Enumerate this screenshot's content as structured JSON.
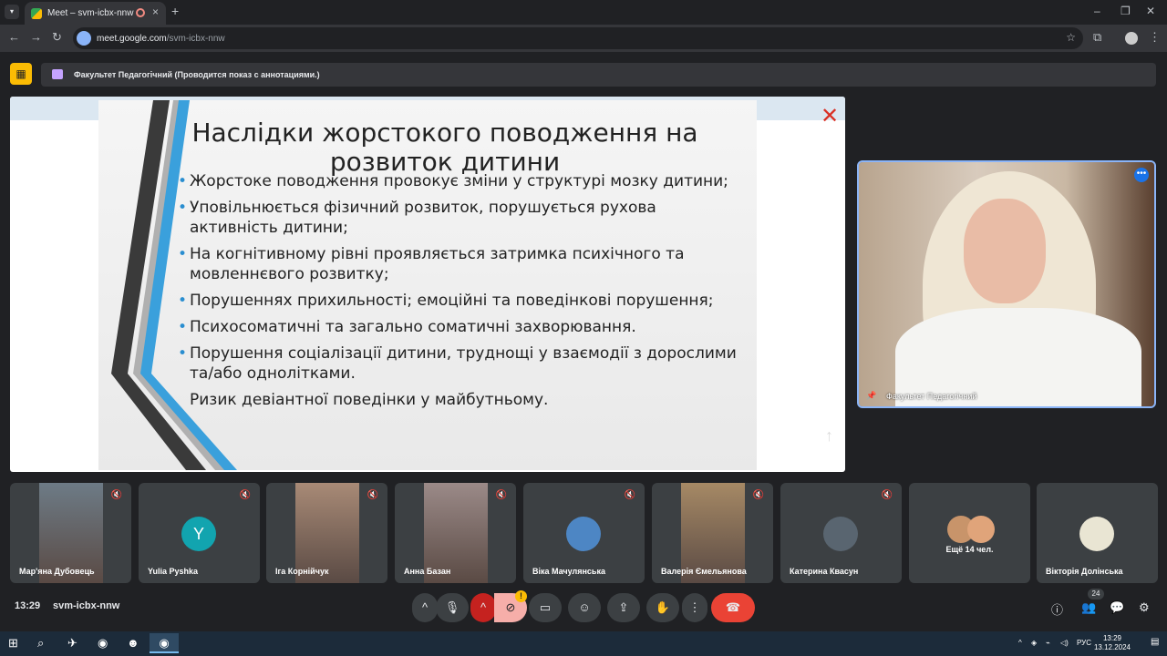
{
  "browser": {
    "tab_title": "Meet – svm-icbx-nnw",
    "new_tab": "+",
    "url_host": "meet.google.com",
    "url_path": "/svm-icbx-nnw"
  },
  "banner": {
    "text": "Факультет Педагогічний (Проводится показ с аннотациями.)"
  },
  "slide": {
    "title": "Наслідки жорстокого поводження на розвиток дитини",
    "bullets": [
      "Жорстоке поводження провокує зміни у структурі мозку дитини;",
      "Уповільнюється фізичний розвиток, порушується рухова активність дитини;",
      "На когнітивному рівні проявляється затримка психічного та мовленнєвого розвитку;",
      "Порушеннях прихильності; емоційні та поведінкові порушення;",
      "Психосоматичні та загально соматичні захворювання.",
      "Порушення соціалізації дитини, труднощі у взаємодії з дорослими та/або однолітками.",
      "Ризик девіантної поведінки у майбутньому."
    ]
  },
  "speaker": {
    "name": "Факультет Педагогічний"
  },
  "participants": [
    {
      "name": "Мар'яна Дубовець",
      "avatar": "",
      "color": "#6d7b86"
    },
    {
      "name": "Yulia Pyshka",
      "avatar": "Y",
      "color": "#12a4af"
    },
    {
      "name": "Іга Корнійчук",
      "avatar": "",
      "color": "#a88a76"
    },
    {
      "name": "Анна Базан",
      "avatar": "",
      "color": "#9b8a88"
    },
    {
      "name": "Віка Мачулянська",
      "avatar": "",
      "color": "#4d86c4"
    },
    {
      "name": "Валерія Ємельянова",
      "avatar": "",
      "color": "#a68965"
    },
    {
      "name": "Катерина Квасун",
      "avatar": "",
      "color": "#596570"
    },
    {
      "name": "Ещё 14 чел.",
      "avatar": "",
      "color": "#c8946a"
    },
    {
      "name": "Вікторія Долінська",
      "avatar": "",
      "color": "#e9e5d3"
    }
  ],
  "meeting": {
    "time": "13:29",
    "code": "svm-icbx-nnw",
    "participants_count": "24",
    "warning_badge": "!"
  },
  "taskbar": {
    "lang": "РУС",
    "time": "13:29",
    "date": "13.12.2024"
  }
}
